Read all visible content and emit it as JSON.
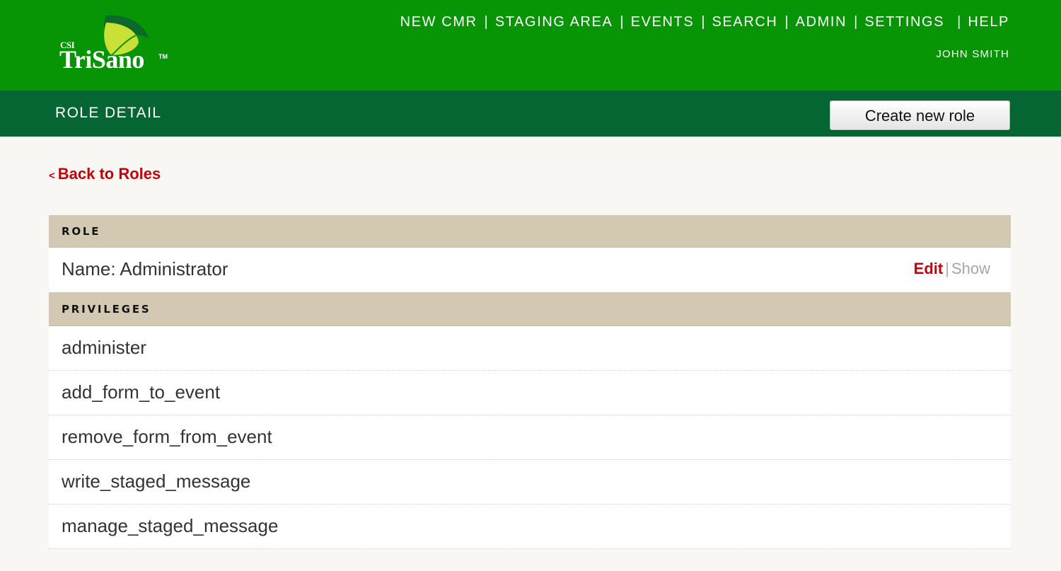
{
  "brand": {
    "csi": "CSI",
    "name": "TriSano",
    "tm": "TM",
    "leaf_color": "#c9e137",
    "dark_leaf_color": "#0b6a2a"
  },
  "nav": {
    "items": [
      {
        "label": "NEW CMR"
      },
      {
        "label": "STAGING AREA"
      },
      {
        "label": "EVENTS"
      },
      {
        "label": "SEARCH"
      },
      {
        "label": "ADMIN"
      },
      {
        "label": "SETTINGS"
      },
      {
        "label": "HELP"
      }
    ],
    "separator": "|",
    "user": "JOHN SMITH"
  },
  "header": {
    "title": "ROLE DETAIL",
    "create_button": "Create new role"
  },
  "back_link": {
    "arrow": "<",
    "label": "Back to Roles"
  },
  "role_section": {
    "heading": "ROLE",
    "name_text": "Name: Administrator",
    "edit_label": "Edit",
    "pipe": "|",
    "show_label": "Show"
  },
  "privileges_section": {
    "heading": "PRIVILEGES",
    "items": [
      "administer",
      "add_form_to_event",
      "remove_form_from_event",
      "write_staged_message",
      "manage_staged_message"
    ]
  },
  "colors": {
    "top_green": "#079405",
    "sub_green": "#066633",
    "accent_red": "#c2030a",
    "section_tan": "#d3c9b2",
    "page_bg": "#f8f7f3"
  }
}
